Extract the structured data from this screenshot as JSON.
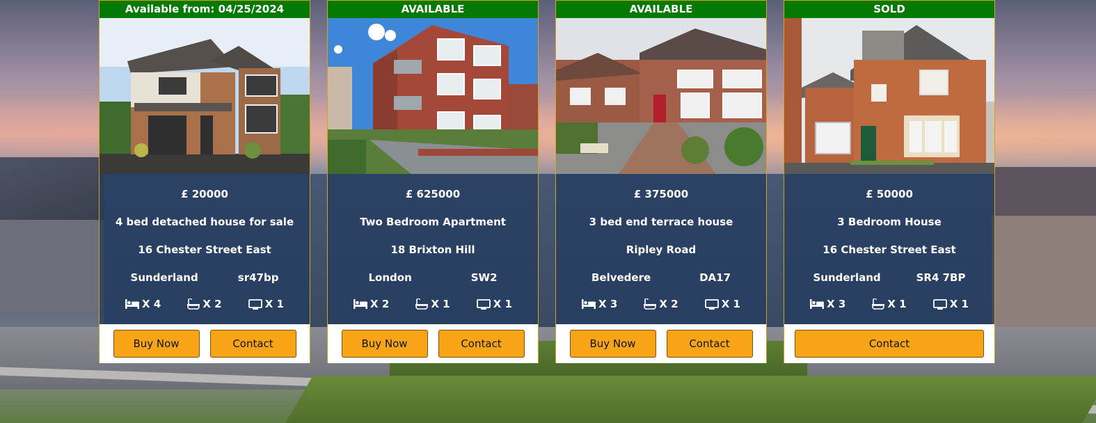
{
  "colors": {
    "status_bar": "#037a03",
    "card_border": "#d9a11a",
    "info_panel": "#243c62",
    "button": "#f7a416"
  },
  "listings": [
    {
      "status": "Available from: 04/25/2024",
      "price": "£ 20000",
      "title": "4 bed detached house for sale",
      "street": "16 Chester Street East",
      "city": "Sunderland",
      "postcode": "sr47bp",
      "beds": "X 4",
      "baths": "X 2",
      "receptions": "X 1",
      "buy_label": "Buy Now",
      "contact_label": "Contact",
      "icons": [
        "bed-icon",
        "bath-icon",
        "tv-icon"
      ]
    },
    {
      "status": "AVAILABLE",
      "price": "£ 625000",
      "title": "Two Bedroom Apartment",
      "street": "18 Brixton Hill",
      "city": "London",
      "postcode": "SW2",
      "beds": "X 2",
      "baths": "X 1",
      "receptions": "X 1",
      "buy_label": "Buy Now",
      "contact_label": "Contact",
      "icons": [
        "bed-icon",
        "bath-icon",
        "tv-icon"
      ]
    },
    {
      "status": "AVAILABLE",
      "price": "£ 375000",
      "title": "3 bed end terrace house",
      "street": "Ripley Road",
      "city": "Belvedere",
      "postcode": "DA17",
      "beds": "X 3",
      "baths": "X 2",
      "receptions": "X 1",
      "buy_label": "Buy Now",
      "contact_label": "Contact",
      "icons": [
        "bed-icon",
        "bath-icon",
        "tv-icon"
      ]
    },
    {
      "status": "SOLD",
      "price": "£ 50000",
      "title": "3 Bedroom House",
      "street": "16 Chester Street East",
      "city": "Sunderland",
      "postcode": "SR4 7BP",
      "beds": "X 3",
      "baths": "X 1",
      "receptions": "X 1",
      "contact_label": "Contact",
      "icons": [
        "bed-icon",
        "bath-icon",
        "tv-icon"
      ]
    }
  ]
}
